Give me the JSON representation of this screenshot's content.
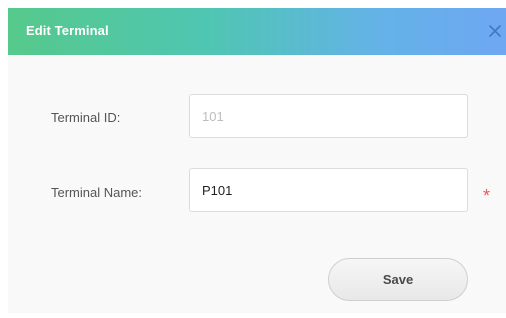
{
  "dialog": {
    "title": "Edit Terminal",
    "close_icon": "close-icon",
    "accent_gradient": [
      "#56c98b",
      "#6ea7f2"
    ]
  },
  "form": {
    "terminal_id": {
      "label": "Terminal ID:",
      "value": "101",
      "disabled": true
    },
    "terminal_name": {
      "label": "Terminal Name:",
      "value": "P101",
      "required_marker": "*"
    }
  },
  "actions": {
    "save_label": "Save"
  }
}
